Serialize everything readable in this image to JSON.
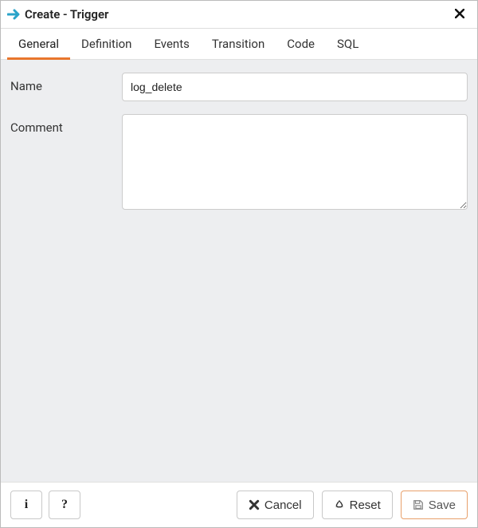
{
  "header": {
    "title": "Create - Trigger"
  },
  "tabs": [
    {
      "label": "General",
      "active": true
    },
    {
      "label": "Definition",
      "active": false
    },
    {
      "label": "Events",
      "active": false
    },
    {
      "label": "Transition",
      "active": false
    },
    {
      "label": "Code",
      "active": false
    },
    {
      "label": "SQL",
      "active": false
    }
  ],
  "form": {
    "name_label": "Name",
    "name_value": "log_delete",
    "comment_label": "Comment",
    "comment_value": ""
  },
  "footer": {
    "info_label": "i",
    "help_label": "?",
    "cancel_label": "Cancel",
    "reset_label": "Reset",
    "save_label": "Save"
  }
}
